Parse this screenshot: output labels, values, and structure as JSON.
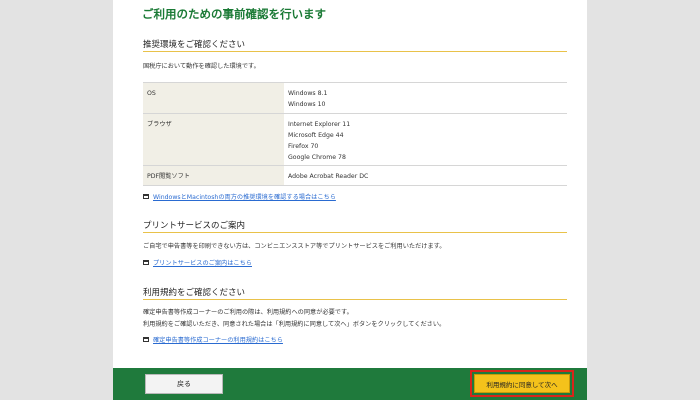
{
  "page_title": "ご利用のための事前確認を行います",
  "env": {
    "heading": "推奨環境をご確認ください",
    "intro": "国税庁において動作を確認した環境です。",
    "rows": [
      {
        "label": "OS",
        "lines": [
          "Windows 8.1",
          "Windows 10"
        ]
      },
      {
        "label": "ブラウザ",
        "lines": [
          "Internet Explorer 11",
          "Microsoft Edge 44",
          "Firefox 70",
          "Google Chrome 78"
        ]
      },
      {
        "label": "PDF閲覧ソフト",
        "lines": [
          "Adobe Acrobat Reader DC"
        ]
      }
    ],
    "link": "WindowsとMacintoshの両方の推奨環境を確認する場合はこちら"
  },
  "print": {
    "heading": "プリントサービスのご案内",
    "text": "ご自宅で申告書等を印刷できない方は、コンビニエンスストア等でプリントサービスをご利用いただけます。",
    "link": "プリントサービスのご案内はこちら"
  },
  "terms": {
    "heading": "利用規約をご確認ください",
    "text1": "確定申告書等作成コーナーのご利用の際は、利用規約への同意が必要です。",
    "text2": "利用規約をご確認いただき、同意された場合は「利用規約に同意して次へ」ボタンをクリックしてください。",
    "link": "確定申告書等作成コーナーの利用規約はこちら"
  },
  "footer": {
    "back_label": "戻る",
    "agree_label": "利用規約に同意して次へ"
  },
  "colors": {
    "title_green": "#1a7a35",
    "footer_green": "#1f7a3c",
    "rule_gold": "#e9c24a",
    "button_yellow": "#f4c21b",
    "highlight_red": "#d9251b",
    "link_blue": "#2a6bd1"
  }
}
